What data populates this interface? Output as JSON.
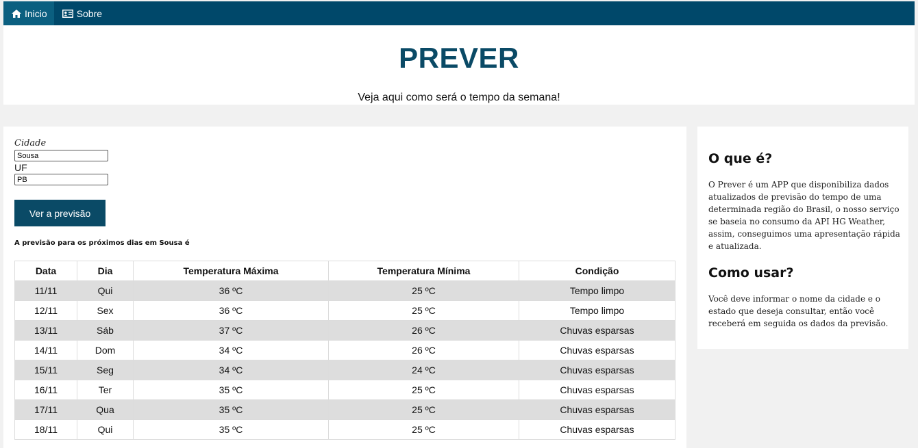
{
  "nav": {
    "items": [
      {
        "label": "Inicio",
        "icon": "home-icon"
      },
      {
        "label": "Sobre",
        "icon": "id-card-icon"
      }
    ]
  },
  "header": {
    "title": "PREVER",
    "subtitle": "Veja aqui como será o tempo da semana!"
  },
  "form": {
    "city_label": "Cidade",
    "city_value": "Sousa",
    "uf_label": "UF",
    "uf_value": "PB",
    "submit_label": "Ver a previsão"
  },
  "result": {
    "title": "A previsão para os próximos dias em Sousa é",
    "columns": [
      "Data",
      "Dia",
      "Temperatura Máxima",
      "Temperatura Mínima",
      "Condição"
    ],
    "rows": [
      [
        "11/11",
        "Qui",
        "36 ºC",
        "25 ºC",
        "Tempo limpo"
      ],
      [
        "12/11",
        "Sex",
        "36 ºC",
        "25 ºC",
        "Tempo limpo"
      ],
      [
        "13/11",
        "Sáb",
        "37 ºC",
        "26 ºC",
        "Chuvas esparsas"
      ],
      [
        "14/11",
        "Dom",
        "34 ºC",
        "26 ºC",
        "Chuvas esparsas"
      ],
      [
        "15/11",
        "Seg",
        "34 ºC",
        "24 ºC",
        "Chuvas esparsas"
      ],
      [
        "16/11",
        "Ter",
        "35 ºC",
        "25 ºC",
        "Chuvas esparsas"
      ],
      [
        "17/11",
        "Qua",
        "35 ºC",
        "25 ºC",
        "Chuvas esparsas"
      ],
      [
        "18/11",
        "Qui",
        "35 ºC",
        "25 ºC",
        "Chuvas esparsas"
      ]
    ]
  },
  "sidebar": {
    "what_title": "O que é?",
    "what_text": "O Prever é um APP que disponibiliza dados atualizados de previsão do tempo de uma determinada região do Brasil, o nosso serviço se baseia no consumo da API HG Weather, assim, conseguimos uma apresentação rápida e atualizada.",
    "how_title": "Como usar?",
    "how_text": "Você deve informar o nome da cidade e o estado que deseja consultar, então você receberá em seguida os dados da previsão."
  }
}
